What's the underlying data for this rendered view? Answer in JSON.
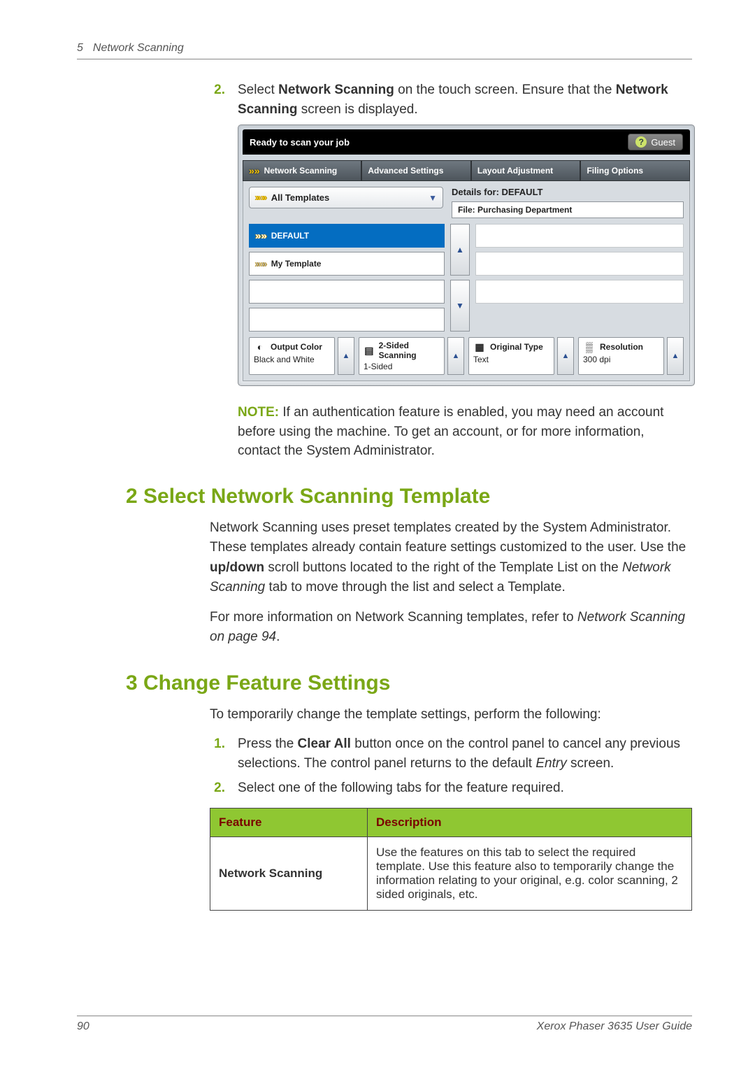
{
  "header": {
    "chapter": "5",
    "title": "Network Scanning"
  },
  "step2": {
    "num": "2.",
    "text_before": "Select ",
    "bold1": "Network Scanning",
    "text_mid": " on the touch screen. Ensure that the ",
    "bold2": "Network Scanning",
    "text_after": " screen is displayed."
  },
  "touchscreen": {
    "title": "Ready to scan your job",
    "guest": "Guest",
    "tabs": {
      "network": "Network Scanning",
      "advanced": "Advanced Settings",
      "layout": "Layout Adjustment",
      "filing": "Filing Options"
    },
    "all_templates": "All Templates",
    "details_for": "Details for: DEFAULT",
    "file_label": "File: Purchasing Department",
    "templates": {
      "default": "DEFAULT",
      "mine": "My Template"
    },
    "options": {
      "output_color": {
        "title": "Output Color",
        "value": "Black and White"
      },
      "two_sided": {
        "title": "2-Sided Scanning",
        "value": "1-Sided"
      },
      "original_type": {
        "title": "Original Type",
        "value": "Text"
      },
      "resolution": {
        "title": "Resolution",
        "value": "300 dpi"
      }
    }
  },
  "note": {
    "label": "NOTE:",
    "text": " If an authentication feature is enabled, you may need an account before using the machine. To get an account, or for more information, contact the System Administrator."
  },
  "section2": {
    "heading": "2 Select Network Scanning Template",
    "p1_a": "Network Scanning uses preset templates created by the System Administrator. These templates already contain feature settings customized to the user. Use the ",
    "p1_bold": "up/down",
    "p1_b": " scroll buttons located to the right of the Template List on the ",
    "p1_italic": "Network Scanning",
    "p1_c": " tab to move through the list and select a Template.",
    "p2_a": "For more information on Network Scanning templates, refer to ",
    "p2_italic": "Network Scanning on page 94",
    "p2_b": "."
  },
  "section3": {
    "heading": "3 Change Feature Settings",
    "intro": "To temporarily change the template settings, perform the following:",
    "s1": {
      "num": "1.",
      "a": "Press the ",
      "bold": "Clear All",
      "b": " button once on the control panel to cancel any previous selections.  The control panel returns to the default ",
      "italic": "Entry",
      "c": " screen."
    },
    "s2": {
      "num": "2.",
      "text": "Select one of the following tabs for the feature required."
    }
  },
  "table": {
    "h1": "Feature",
    "h2": "Description",
    "row1_name": "Network Scanning",
    "row1_desc": "Use the features on this tab to select the required template. Use this feature also to temporarily change the information relating to your original, e.g. color scanning, 2 sided originals, etc."
  },
  "footer": {
    "page": "90",
    "guide": "Xerox Phaser 3635 User Guide"
  }
}
